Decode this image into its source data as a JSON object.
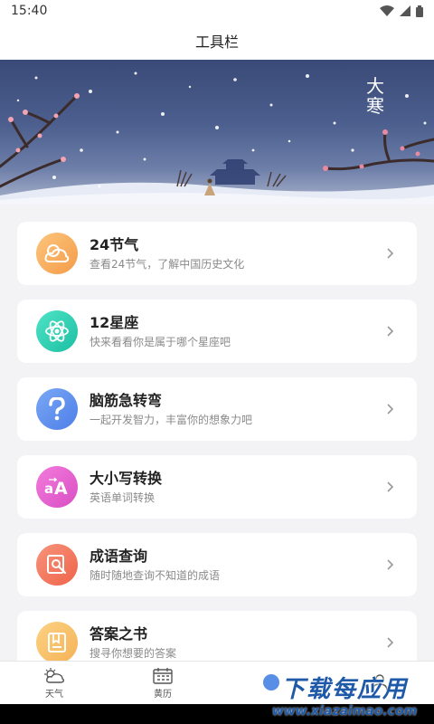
{
  "status": {
    "time": "15:40"
  },
  "titlebar": {
    "title": "工具栏"
  },
  "banner": {
    "title": "大寒"
  },
  "cards": [
    {
      "title": "24节气",
      "subtitle": "查看24节气，了解中国历史文化",
      "icon": "cloud-sun-icon",
      "color": "#f6ac5b"
    },
    {
      "title": "12星座",
      "subtitle": "快来看看你是属于哪个星座吧",
      "icon": "atom-icon",
      "color": "#2ed3b5"
    },
    {
      "title": "脑筋急转弯",
      "subtitle": "一起开发智力，丰富你的想象力吧",
      "icon": "question-icon",
      "color": "#5b8def"
    },
    {
      "title": "大小写转换",
      "subtitle": "英语单词转换",
      "icon": "case-convert-icon",
      "color": "#e45ed0"
    },
    {
      "title": "成语查询",
      "subtitle": "随时随地查询不知道的成语",
      "icon": "idiom-search-icon",
      "color": "#f2765e"
    },
    {
      "title": "答案之书",
      "subtitle": "搜寻你想要的答案",
      "icon": "book-icon",
      "color": "#f8c06a"
    }
  ],
  "nav": [
    {
      "label": "天气",
      "icon": "weather-icon"
    },
    {
      "label": "黄历",
      "icon": "calendar-icon"
    },
    {
      "label": "",
      "icon": "tools-icon"
    },
    {
      "label": "",
      "icon": "profile-icon"
    }
  ],
  "watermark": {
    "main": "下载每应用",
    "sub": "www.xiazaimao.com"
  },
  "colors": {
    "accent_blue": "#1f5aa8",
    "card_bg": "#ffffff",
    "page_bg": "#f3f3f6"
  }
}
